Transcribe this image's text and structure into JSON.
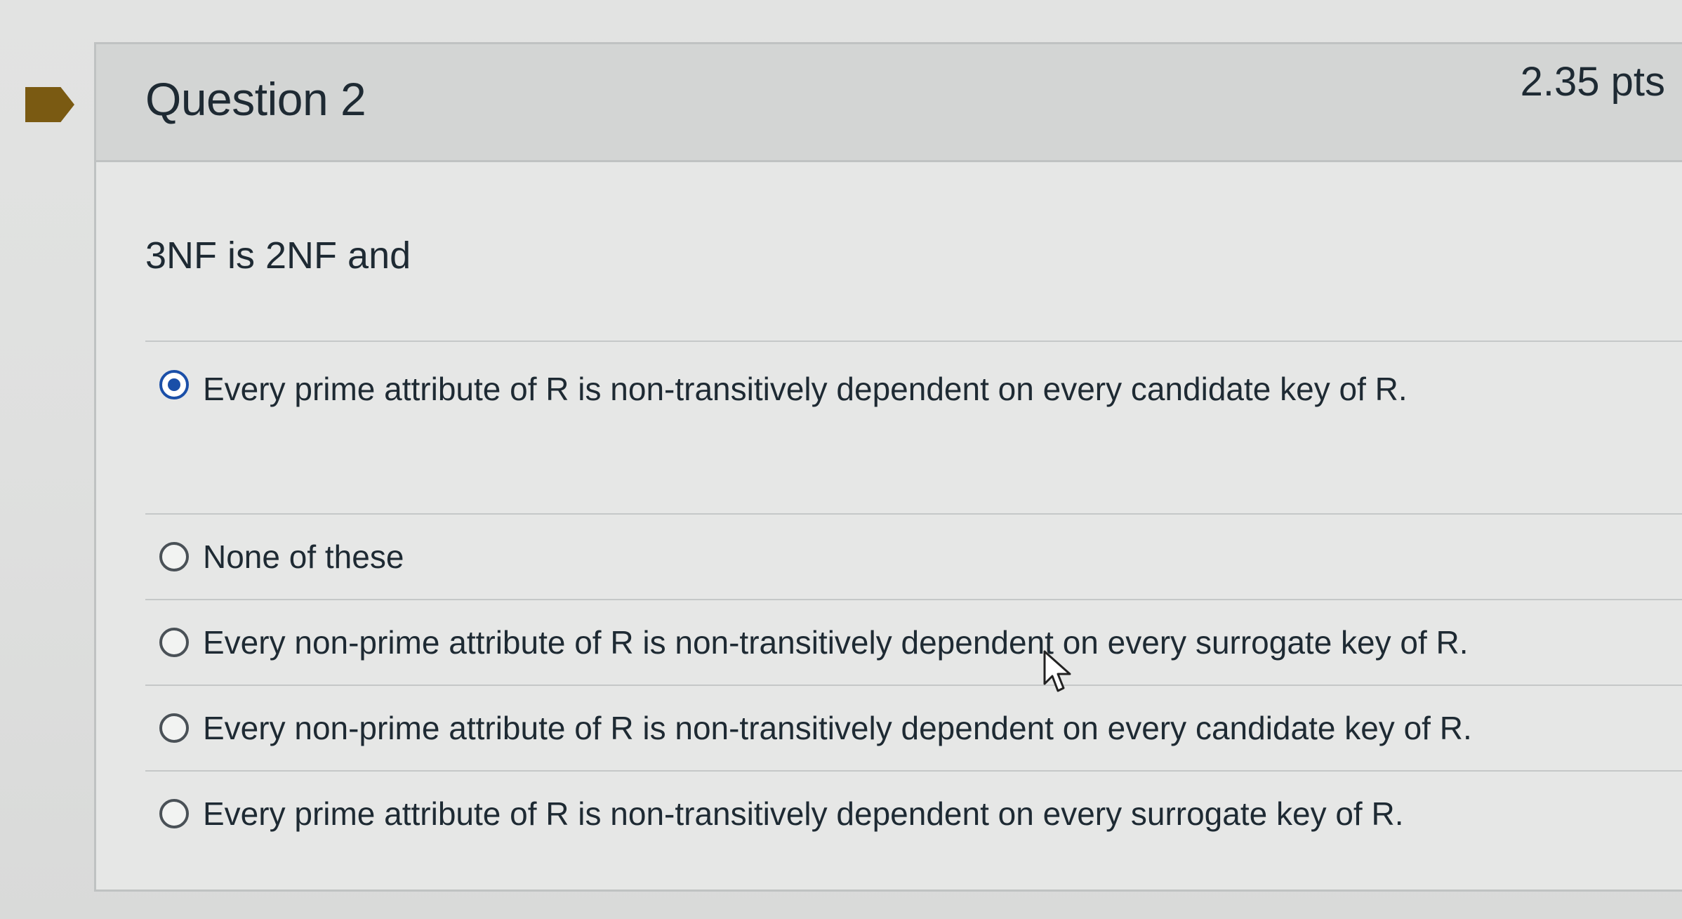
{
  "question": {
    "title": "Question 2",
    "points": "2.35 pts",
    "text": "3NF is 2NF and",
    "answers": [
      {
        "label": "Every prime attribute of R is non-transitively dependent on every candidate key of R.",
        "selected": true
      },
      {
        "label": "None of these",
        "selected": false
      },
      {
        "label": "Every non-prime attribute of R is non-transitively dependent on every surrogate key of R.",
        "selected": false
      },
      {
        "label": "Every non-prime attribute of R is non-transitively dependent on every candidate key of R.",
        "selected": false
      },
      {
        "label": "Every prime attribute of R is non-transitively dependent on every surrogate key of R.",
        "selected": false
      }
    ]
  },
  "colors": {
    "flag": "#7a5a12",
    "selected_radio": "#1a4fa8"
  },
  "icons": {
    "flag": "bookmark-flag-icon",
    "cursor": "mouse-pointer-icon"
  }
}
